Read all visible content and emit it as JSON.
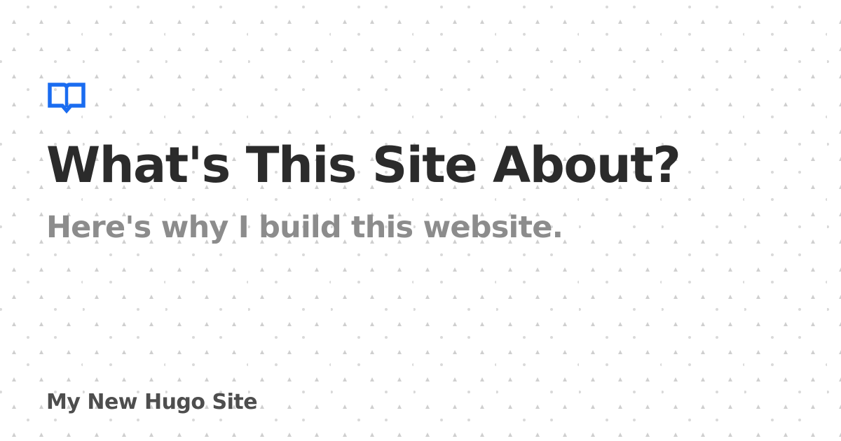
{
  "page": {
    "title": "What's This Site About?",
    "subtitle": "Here's why I build this website.",
    "site_name": "My New Hugo Site"
  },
  "logo": {
    "icon": "open-book-icon",
    "color": "#1a6cf0"
  },
  "colors": {
    "background": "#ffffff",
    "title": "#2b2b2b",
    "subtitle": "#8c8c8c",
    "site_name": "#4e4e4e",
    "pattern_dots": "#cfcfcf"
  }
}
